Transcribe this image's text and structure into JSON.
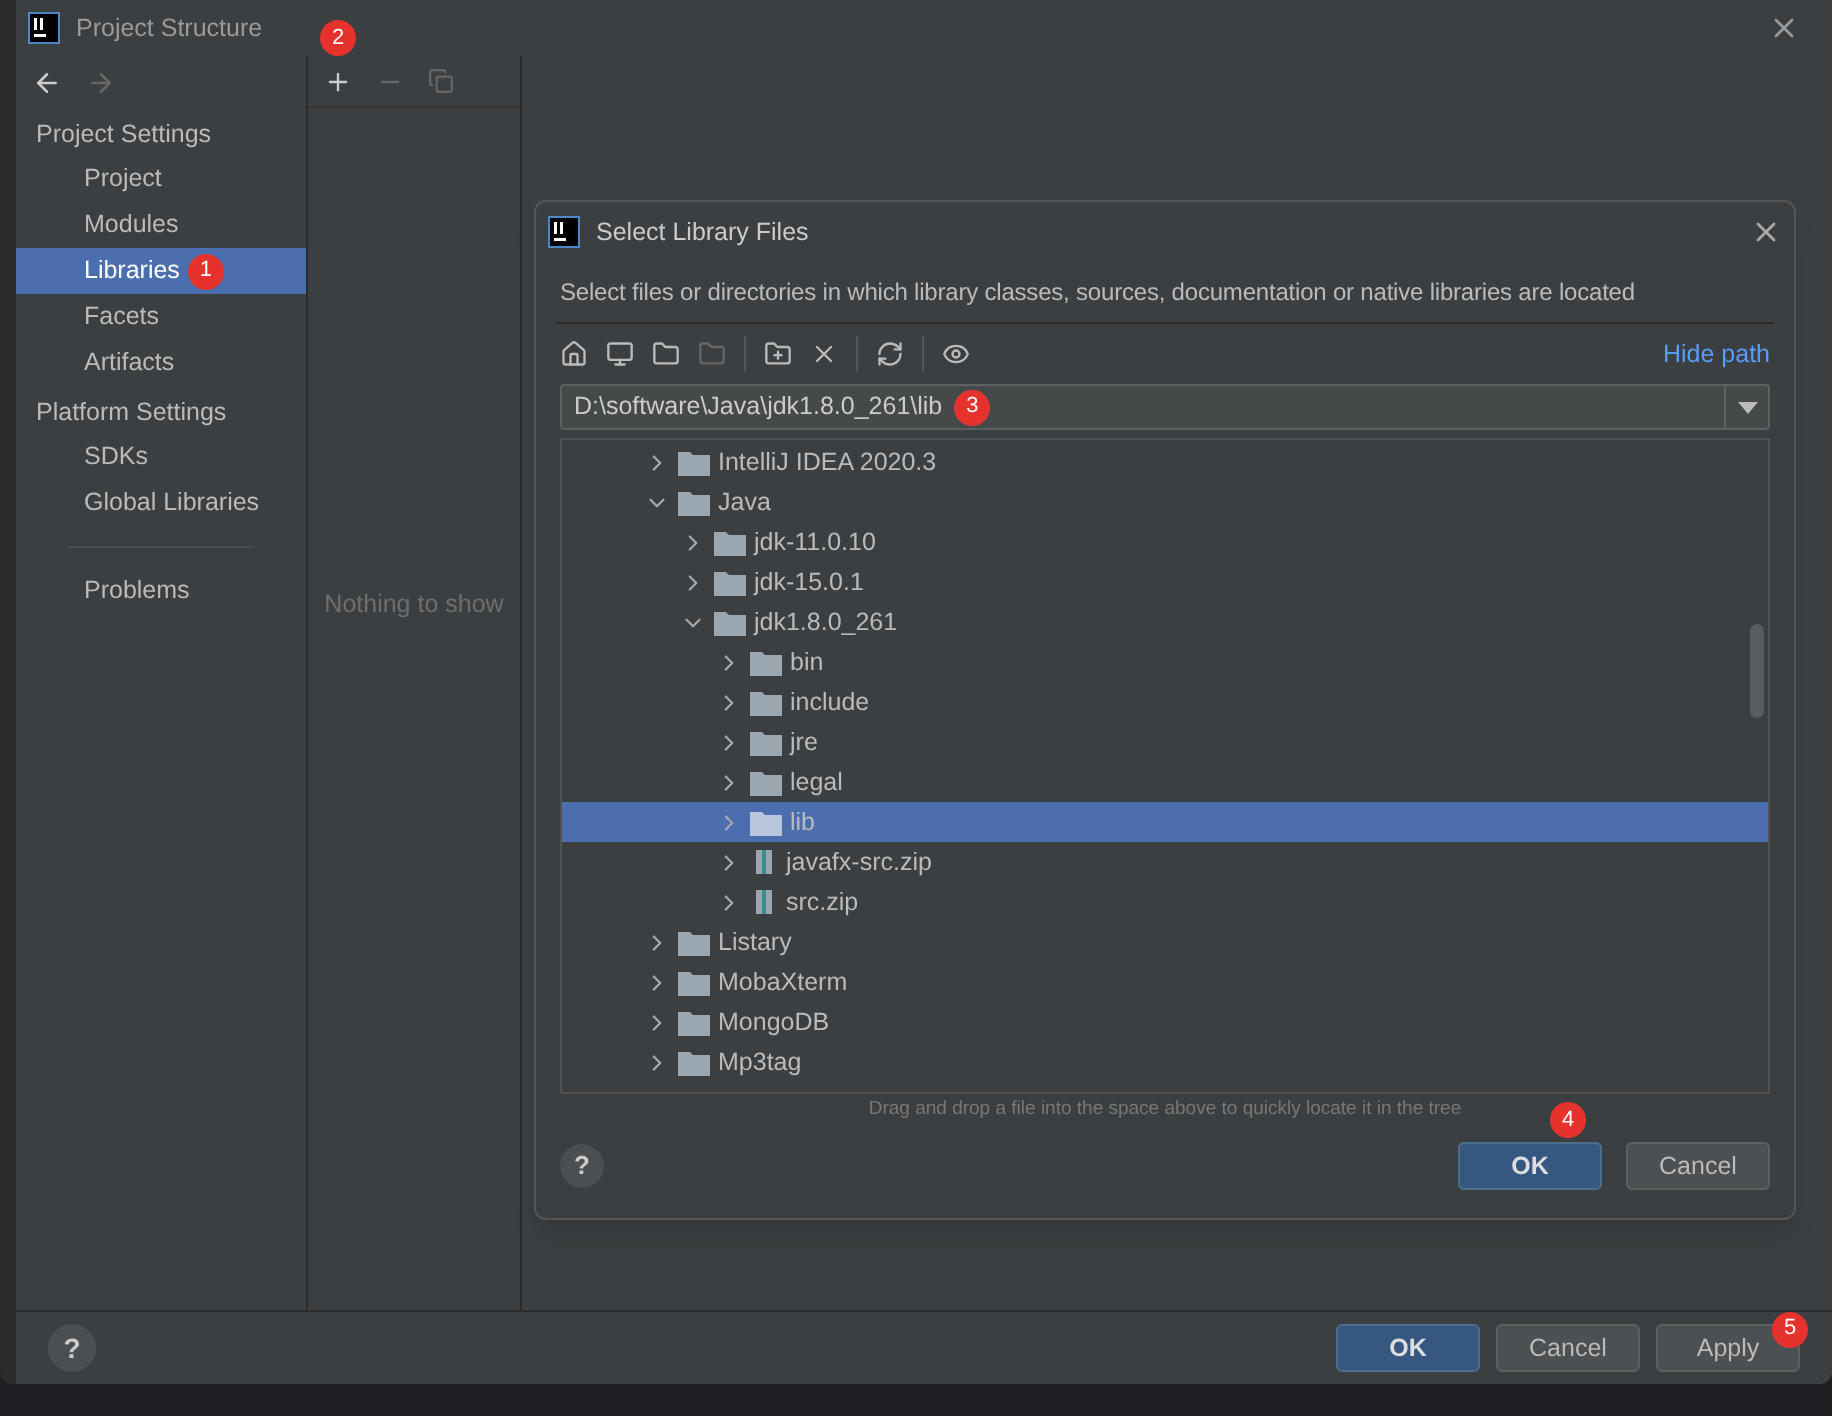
{
  "window": {
    "title": "Project Structure"
  },
  "sidebar": {
    "sections": [
      {
        "heading": "Project Settings",
        "items": [
          {
            "label": "Project",
            "selected": false
          },
          {
            "label": "Modules",
            "selected": false
          },
          {
            "label": "Libraries",
            "selected": true,
            "badge": "1"
          },
          {
            "label": "Facets",
            "selected": false
          },
          {
            "label": "Artifacts",
            "selected": false
          }
        ]
      },
      {
        "heading": "Platform Settings",
        "items": [
          {
            "label": "SDKs",
            "selected": false
          },
          {
            "label": "Global Libraries",
            "selected": false
          }
        ]
      }
    ],
    "bottom_items": [
      {
        "label": "Problems",
        "selected": false
      }
    ]
  },
  "list_panel": {
    "add_badge": "2",
    "empty_text": "Nothing to show"
  },
  "dialog": {
    "title": "Select Library Files",
    "description": "Select files or directories in which library classes, sources, documentation or native libraries are located",
    "hide_path_link": "Hide path",
    "path": "D:\\software\\Java\\jdk1.8.0_261\\lib",
    "path_badge": "3",
    "tree": [
      {
        "label": "IntelliJ IDEA 2020.3",
        "kind": "folder",
        "expanded": false,
        "selected": false
      },
      {
        "label": "Java",
        "kind": "folder",
        "expanded": true,
        "selected": false,
        "children": [
          {
            "label": "jdk-11.0.10",
            "kind": "folder",
            "expanded": false,
            "selected": false
          },
          {
            "label": "jdk-15.0.1",
            "kind": "folder",
            "expanded": false,
            "selected": false
          },
          {
            "label": "jdk1.8.0_261",
            "kind": "folder",
            "expanded": true,
            "selected": false,
            "children": [
              {
                "label": "bin",
                "kind": "folder",
                "expanded": false,
                "selected": false
              },
              {
                "label": "include",
                "kind": "folder",
                "expanded": false,
                "selected": false
              },
              {
                "label": "jre",
                "kind": "folder",
                "expanded": false,
                "selected": false
              },
              {
                "label": "legal",
                "kind": "folder",
                "expanded": false,
                "selected": false
              },
              {
                "label": "lib",
                "kind": "folder",
                "expanded": false,
                "selected": true
              },
              {
                "label": "javafx-src.zip",
                "kind": "archive",
                "expanded": false,
                "selected": false
              },
              {
                "label": "src.zip",
                "kind": "archive",
                "expanded": false,
                "selected": false
              }
            ]
          }
        ]
      },
      {
        "label": "Listary",
        "kind": "folder",
        "expanded": false,
        "selected": false
      },
      {
        "label": "MobaXterm",
        "kind": "folder",
        "expanded": false,
        "selected": false
      },
      {
        "label": "MongoDB",
        "kind": "folder",
        "expanded": false,
        "selected": false
      },
      {
        "label": "Mp3tag",
        "kind": "folder",
        "expanded": false,
        "selected": false
      }
    ],
    "help_button": "?",
    "hint": "Drag and drop a file into the space above to quickly locate it in the tree",
    "buttons": [
      {
        "label": "OK",
        "default": true,
        "badge": "4"
      },
      {
        "label": "Cancel",
        "default": false
      }
    ]
  },
  "footer": {
    "help_button": "?",
    "buttons": [
      {
        "label": "OK",
        "default": true
      },
      {
        "label": "Cancel",
        "default": false
      },
      {
        "label": "Apply",
        "default": false,
        "badge": "5"
      }
    ]
  }
}
